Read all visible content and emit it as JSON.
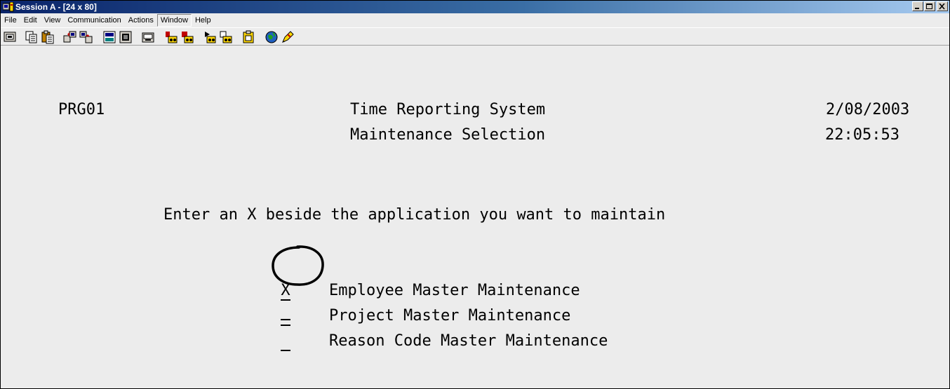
{
  "window": {
    "title": "Session A - [24 x 80]",
    "buttons": [
      "minimize",
      "maximize",
      "close"
    ]
  },
  "menubar": {
    "items": [
      "File",
      "Edit",
      "View",
      "Communication",
      "Actions",
      "Window",
      "Help"
    ],
    "active": "Window"
  },
  "toolbar": {
    "icons": [
      "display-session-icon",
      "copy-icon",
      "paste-icon",
      "send-file-icon",
      "receive-file-icon",
      "print-screen-icon",
      "display-icon",
      "keyboard-map-icon",
      "record-macro-icon",
      "stop-macro-icon",
      "play-macro-icon",
      "macro-setup-icon",
      "clipboard-icon",
      "help-globe-icon",
      "pen-icon"
    ]
  },
  "screen": {
    "program_id": "PRG01",
    "title": "Time Reporting System",
    "subtitle": "Maintenance Selection",
    "date": "2/08/2003",
    "time": "22:05:53",
    "instruction": "Enter an X beside the application you want to maintain",
    "options": [
      {
        "value": "X",
        "label": "Employee Master Maintenance"
      },
      {
        "value": "",
        "label": "Project Master Maintenance"
      },
      {
        "value": "",
        "label": "Reason Code Master Maintenance"
      }
    ]
  }
}
